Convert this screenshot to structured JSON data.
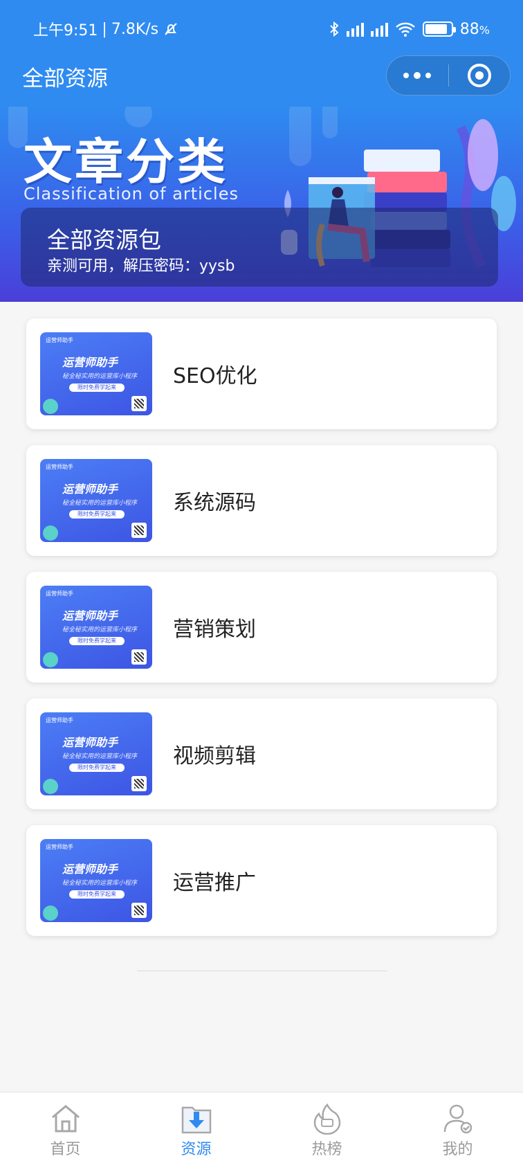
{
  "status_bar": {
    "time": "上午9:51",
    "speed": "7.8K/s",
    "battery": "88",
    "battery_unit": "%",
    "battery_level": 0.88
  },
  "nav": {
    "title": "全部资源"
  },
  "banner": {
    "title": "文章分类",
    "subtitle": "Classification of articles",
    "card_title": "全部资源包",
    "card_desc": "亲测可用，解压密码：yysb"
  },
  "thumbnail": {
    "brand": "运营师助手",
    "tagline": "秘全秘实用的运营库小程序",
    "button": "限时免费学起来",
    "small": "运营师助手"
  },
  "categories": [
    {
      "label": "SEO优化"
    },
    {
      "label": "系统源码"
    },
    {
      "label": "营销策划"
    },
    {
      "label": "视频剪辑"
    },
    {
      "label": "运营推广"
    }
  ],
  "tabbar": {
    "items": [
      {
        "label": "首页",
        "icon": "home-icon",
        "active": false
      },
      {
        "label": "资源",
        "icon": "download-icon",
        "active": true
      },
      {
        "label": "热榜",
        "icon": "fire-icon",
        "active": false
      },
      {
        "label": "我的",
        "icon": "user-icon",
        "active": false
      }
    ],
    "active_color": "#2f8bf0",
    "inactive_color": "#9a9a9a"
  },
  "colors": {
    "primary": "#2f8bf0"
  }
}
